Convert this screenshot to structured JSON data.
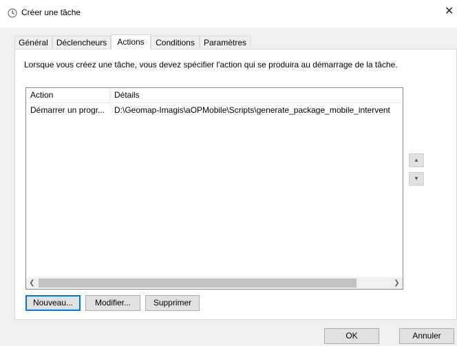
{
  "window": {
    "title": "Créer une tâche",
    "icon": "clock-icon",
    "close_glyph": "✕"
  },
  "tabs": [
    {
      "label": "Général"
    },
    {
      "label": "Déclencheurs"
    },
    {
      "label": "Actions",
      "active": true
    },
    {
      "label": "Conditions"
    },
    {
      "label": "Paramètres"
    }
  ],
  "actions_panel": {
    "description": "Lorsque vous créez une tâche, vous devez spécifier l'action qui se produira au démarrage de la tâche.",
    "columns": [
      "Action",
      "Détails"
    ],
    "rows": [
      {
        "action": "Démarrer un progr...",
        "details": "D:\\Geomap-Imagis\\aOPMobile\\Scripts\\generate_package_mobile_intervent"
      }
    ],
    "move_up_icon": "▲",
    "move_down_icon": "▼",
    "scroll_left_icon": "❮",
    "scroll_right_icon": "❯",
    "buttons": {
      "new": "Nouveau...",
      "edit": "Modifier...",
      "delete": "Supprimer"
    }
  },
  "footer": {
    "ok": "OK",
    "cancel": "Annuler"
  },
  "colors": {
    "dialog_bg": "#f0f0f0",
    "panel_bg": "#ffffff",
    "accent_border": "#0078d7"
  }
}
